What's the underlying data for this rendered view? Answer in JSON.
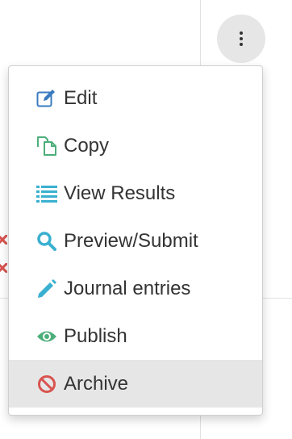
{
  "menu": {
    "items": [
      {
        "label": "Edit",
        "icon": "edit-icon",
        "color": "#3a7bbf"
      },
      {
        "label": "Copy",
        "icon": "copy-icon",
        "color": "#4caf7a"
      },
      {
        "label": "View Results",
        "icon": "list-icon",
        "color": "#3ab0d0"
      },
      {
        "label": "Preview/Submit",
        "icon": "search-icon",
        "color": "#3ab0d0"
      },
      {
        "label": "Journal entries",
        "icon": "pencil-icon",
        "color": "#3ab0d0"
      },
      {
        "label": "Publish",
        "icon": "eye-icon",
        "color": "#4caf7a"
      },
      {
        "label": "Archive",
        "icon": "ban-icon",
        "color": "#d9534f"
      }
    ]
  },
  "colors": {
    "text": "#333333",
    "hover_bg": "#e6e6e6",
    "danger": "#d9534f"
  }
}
